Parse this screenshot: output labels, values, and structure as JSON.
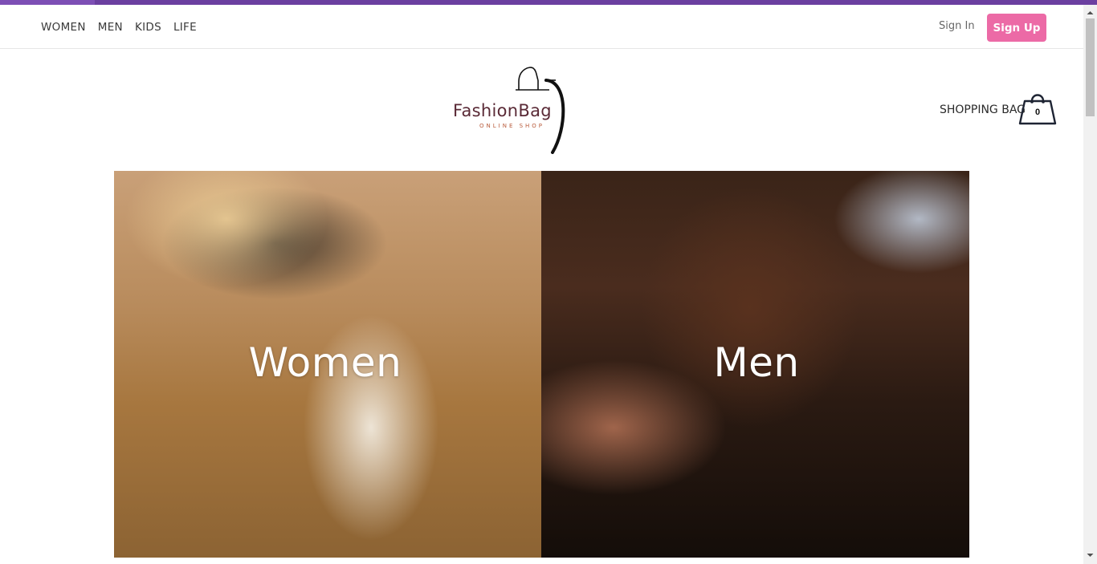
{
  "nav": {
    "links": [
      "WOMEN",
      "MEN",
      "KIDS",
      "LIFE"
    ],
    "sign_in": "Sign In",
    "sign_up": "Sign Up"
  },
  "logo": {
    "name": "FashionBag",
    "tagline": "ONLINE SHOP"
  },
  "cart": {
    "label": "SHOPPING BAG",
    "count": "0"
  },
  "hero": {
    "women": "Women",
    "men": "Men"
  },
  "colors": {
    "accent": "#ec6aa6",
    "top_bar": "#6b3fa0",
    "logo_text": "#5a2a36"
  }
}
